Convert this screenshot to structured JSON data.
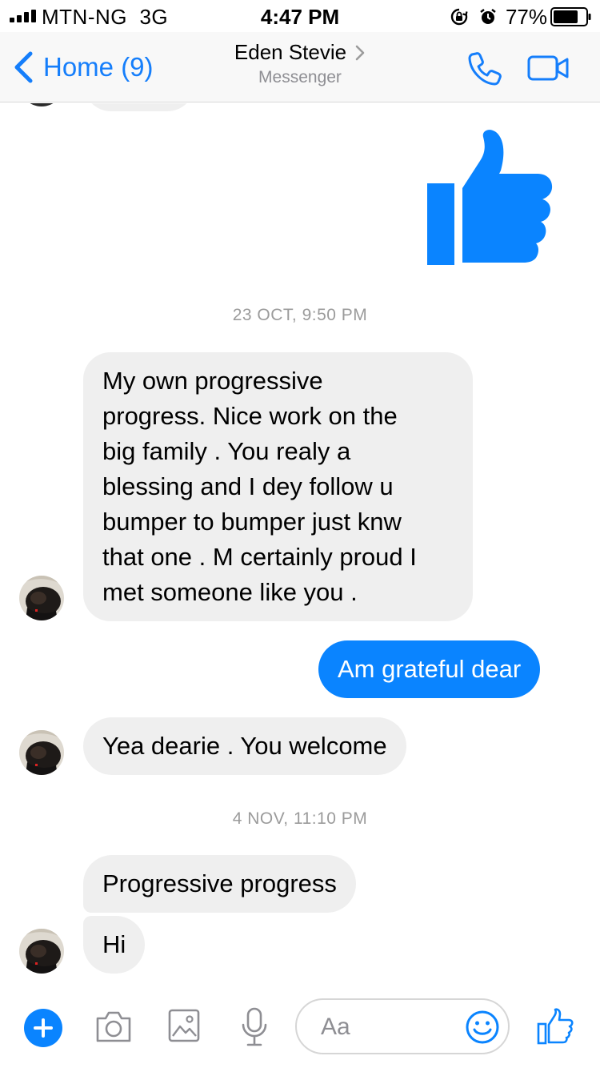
{
  "status_bar": {
    "carrier": "MTN-NG",
    "network": "3G",
    "time": "4:47 PM",
    "battery_percent": "77%",
    "battery_level": 0.77,
    "icons": [
      "signal-icon",
      "orientation-lock-icon",
      "alarm-icon",
      "battery-icon"
    ]
  },
  "header": {
    "back_label": "Home (9)",
    "contact_name": "Eden Stevie",
    "subtitle": "Messenger",
    "icons": [
      "back-chevron-icon",
      "chevron-right-icon",
      "phone-icon",
      "video-camera-icon"
    ]
  },
  "messages": [
    {
      "type": "sticker",
      "direction": "out",
      "sticker": "thumbs-up"
    },
    {
      "type": "timestamp",
      "text": "23 OCT, 9:50 PM"
    },
    {
      "type": "text",
      "direction": "in",
      "lines": [
        "My own progressive",
        "progress. Nice work on the",
        "big family . You realy a",
        "blessing and I dey follow u",
        "bumper to bumper just knw",
        "that one . M certainly proud I",
        "met someone like you ."
      ]
    },
    {
      "type": "text",
      "direction": "out",
      "text": "Am grateful dear"
    },
    {
      "type": "text",
      "direction": "in",
      "text": "Yea dearie . You welcome"
    },
    {
      "type": "timestamp",
      "text": "4 NOV, 11:10 PM"
    },
    {
      "type": "text",
      "direction": "in",
      "text": "Progressive progress"
    },
    {
      "type": "text",
      "direction": "in",
      "text": "Hi"
    }
  ],
  "composer": {
    "placeholder": "Aa",
    "icons": [
      "plus-icon",
      "camera-icon",
      "image-icon",
      "microphone-icon",
      "emoji-icon",
      "thumbs-up-icon"
    ]
  },
  "colors": {
    "accent": "#0a84ff",
    "link": "#157efb",
    "incoming_bubble": "#efefef",
    "timestamp": "#9b9b9b"
  }
}
